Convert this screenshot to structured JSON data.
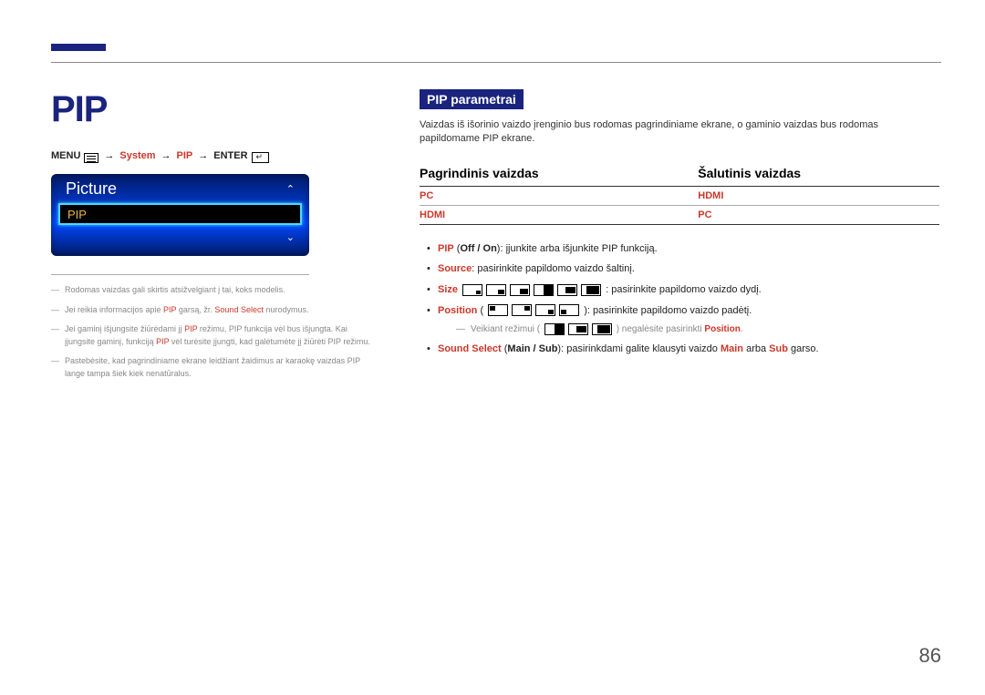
{
  "page": {
    "title": "PIP",
    "number": "86"
  },
  "breadcrumb": {
    "menu": "MENU",
    "system": "System",
    "pip": "PIP",
    "enter": "ENTER"
  },
  "osd": {
    "title": "Picture",
    "item": "PIP"
  },
  "notes": [
    {
      "pre": "Rodomas vaizdas gali skirtis atsižvelgiant į tai, koks modelis."
    },
    {
      "pre": "Jei reikia informacijos apie ",
      "r1": "PIP",
      "mid1": " garsą, žr. ",
      "r2": "Sound Select",
      "post": " nurodymus."
    },
    {
      "pre": "Jei gaminį išjungsite žiūrėdami jį ",
      "r1": "PIP",
      "mid1": " režimu, PIP funkcija vėl bus išjungta. Kai įjungsite gaminį, funkciją ",
      "r2": "PIP",
      "post": " vėl turėsite įjungti, kad galėtumėte jį žiūrėti PIP režimu."
    },
    {
      "pre": "Pastebėsite, kad pagrindiniame ekrane leidžiant žaidimus ar karaokę vaizdas PIP lange tampa šiek kiek nenatūralus."
    }
  ],
  "section": {
    "head": "PIP parametrai",
    "desc": "Vaizdas iš išorinio vaizdo įrenginio bus rodomas pagrindiniame ekrane, o gaminio vaizdas bus rodomas papildomame PIP ekrane."
  },
  "table": {
    "h1": "Pagrindinis vaizdas",
    "h2": "Šalutinis vaizdas",
    "rows": [
      {
        "c1": "PC",
        "c2": "HDMI"
      },
      {
        "c1": "HDMI",
        "c2": "PC"
      }
    ]
  },
  "bullets": {
    "b1": {
      "r": "PIP",
      "p": " (",
      "b": "Off / On",
      "t": "): įjunkite arba išjunkite PIP funkciją."
    },
    "b2": {
      "r": "Source",
      "t": ": pasirinkite papildomo vaizdo šaltinį."
    },
    "b3": {
      "r": "Size",
      "t": ": pasirinkite papildomo vaizdo dydį."
    },
    "b4": {
      "r": "Position",
      "p": " (",
      "t": "): pasirinkite papildomo vaizdo padėtį."
    },
    "b4n": {
      "pre": "Veikiant režimui (",
      "post": ") negalėsite pasirinkti ",
      "r": "Position",
      "end": "."
    },
    "b5": {
      "r": "Sound Select",
      "p": " (",
      "b": "Main / Sub",
      "t": "): pasirinkdami galite klausyti vaizdo ",
      "r2": "Main",
      "mid": " arba ",
      "r3": "Sub",
      "end": " garso."
    }
  }
}
